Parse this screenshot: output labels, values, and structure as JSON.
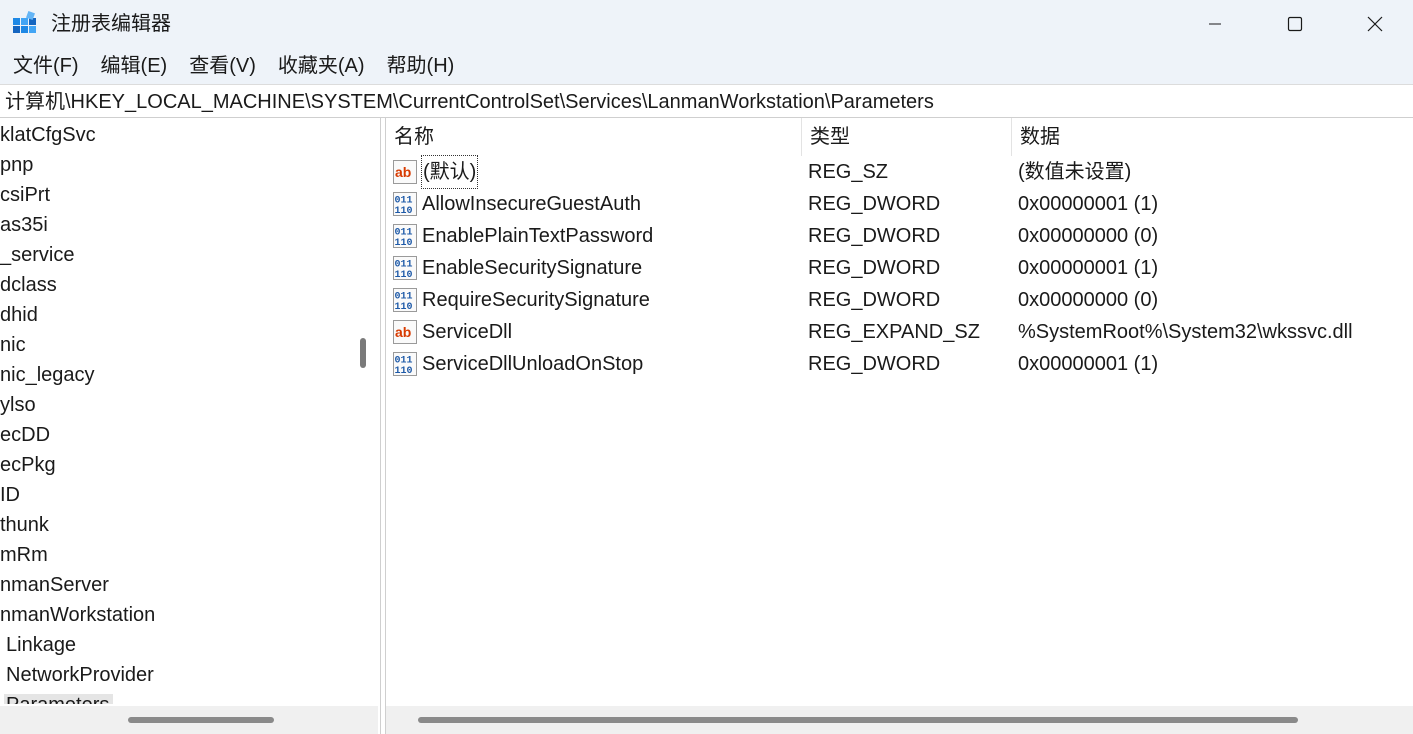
{
  "window": {
    "title": "注册表编辑器",
    "icon": "registry-editor-icon"
  },
  "menu": [
    "文件(F)",
    "编辑(E)",
    "查看(V)",
    "收藏夹(A)",
    "帮助(H)"
  ],
  "address": {
    "path": "计算机\\HKEY_LOCAL_MACHINE\\SYSTEM\\CurrentControlSet\\Services\\LanmanWorkstation\\Parameters"
  },
  "tree": {
    "items": [
      "klatCfgSvc",
      "pnp",
      "csiPrt",
      "as35i",
      "_service",
      "dclass",
      "dhid",
      "nic",
      "nic_legacy",
      "ylso",
      "ecDD",
      "ecPkg",
      "ID",
      "thunk",
      "mRm",
      "nmanServer",
      "nmanWorkstation",
      "Linkage",
      "NetworkProvider",
      "Parameters"
    ],
    "selected_index": 19
  },
  "columns": {
    "name": "名称",
    "type": "类型",
    "data": "数据"
  },
  "values": [
    {
      "name": "(默认)",
      "type": "REG_SZ",
      "data": "(数值未设置)",
      "icon": "string-value-icon"
    },
    {
      "name": "AllowInsecureGuestAuth",
      "type": "REG_DWORD",
      "data": "0x00000001 (1)",
      "icon": "binary-value-icon"
    },
    {
      "name": "EnablePlainTextPassword",
      "type": "REG_DWORD",
      "data": "0x00000000 (0)",
      "icon": "binary-value-icon"
    },
    {
      "name": "EnableSecuritySignature",
      "type": "REG_DWORD",
      "data": "0x00000001 (1)",
      "icon": "binary-value-icon"
    },
    {
      "name": "RequireSecuritySignature",
      "type": "REG_DWORD",
      "data": "0x00000000 (0)",
      "icon": "binary-value-icon"
    },
    {
      "name": "ServiceDll",
      "type": "REG_EXPAND_SZ",
      "data": "%SystemRoot%\\System32\\wkssvc.dll",
      "icon": "string-value-icon"
    },
    {
      "name": "ServiceDllUnloadOnStop",
      "type": "REG_DWORD",
      "data": "0x00000001 (1)",
      "icon": "binary-value-icon"
    }
  ],
  "colors": {
    "titlebar_bg": "#eef3f9",
    "string_icon_red": "#d83b01",
    "binary_icon_blue": "#1e5aa8"
  }
}
